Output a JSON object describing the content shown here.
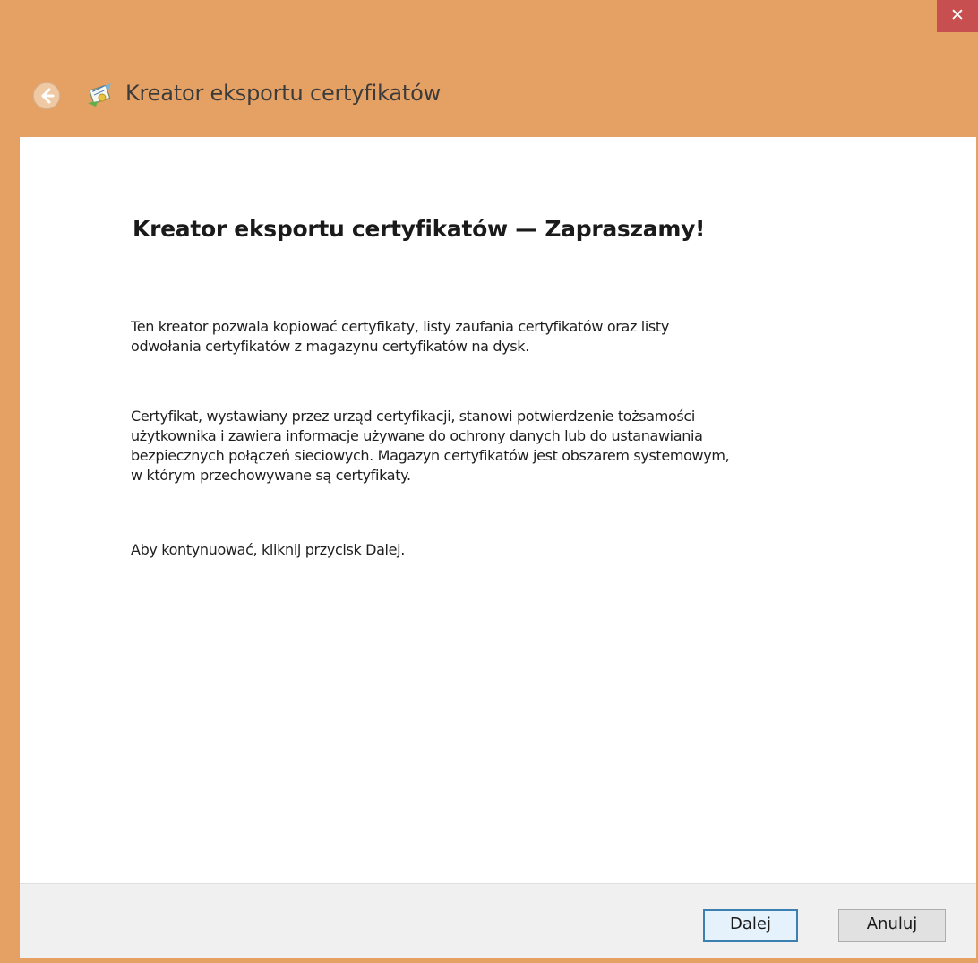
{
  "window": {
    "title": "Kreator eksportu certyfikatów",
    "close_symbol": "✕",
    "accent_color": "#e5a063",
    "close_color": "#c74f4f"
  },
  "header": {
    "back_icon": "back-arrow-icon",
    "app_icon": "certificate-wizard-icon"
  },
  "content": {
    "heading": "Kreator eksportu certyfikatów — Zapraszamy!",
    "paragraph1": "Ten kreator pozwala kopiować certyfikaty, listy zaufania certyfikatów oraz listy\nodwołania certyfikatów z magazynu certyfikatów na dysk.",
    "paragraph2": "Certyfikat, wystawiany przez urząd certyfikacji, stanowi potwierdzenie tożsamości\nużytkownika i zawiera informacje używane do ochrony danych lub do ustanawiania\nbezpiecznych połączeń sieciowych. Magazyn certyfikatów jest obszarem systemowym,\nw którym przechowywane są certyfikaty.",
    "paragraph3": "Aby kontynuować, kliknij przycisk Dalej."
  },
  "footer": {
    "next_label": "Dalej",
    "cancel_label": "Anuluj"
  }
}
